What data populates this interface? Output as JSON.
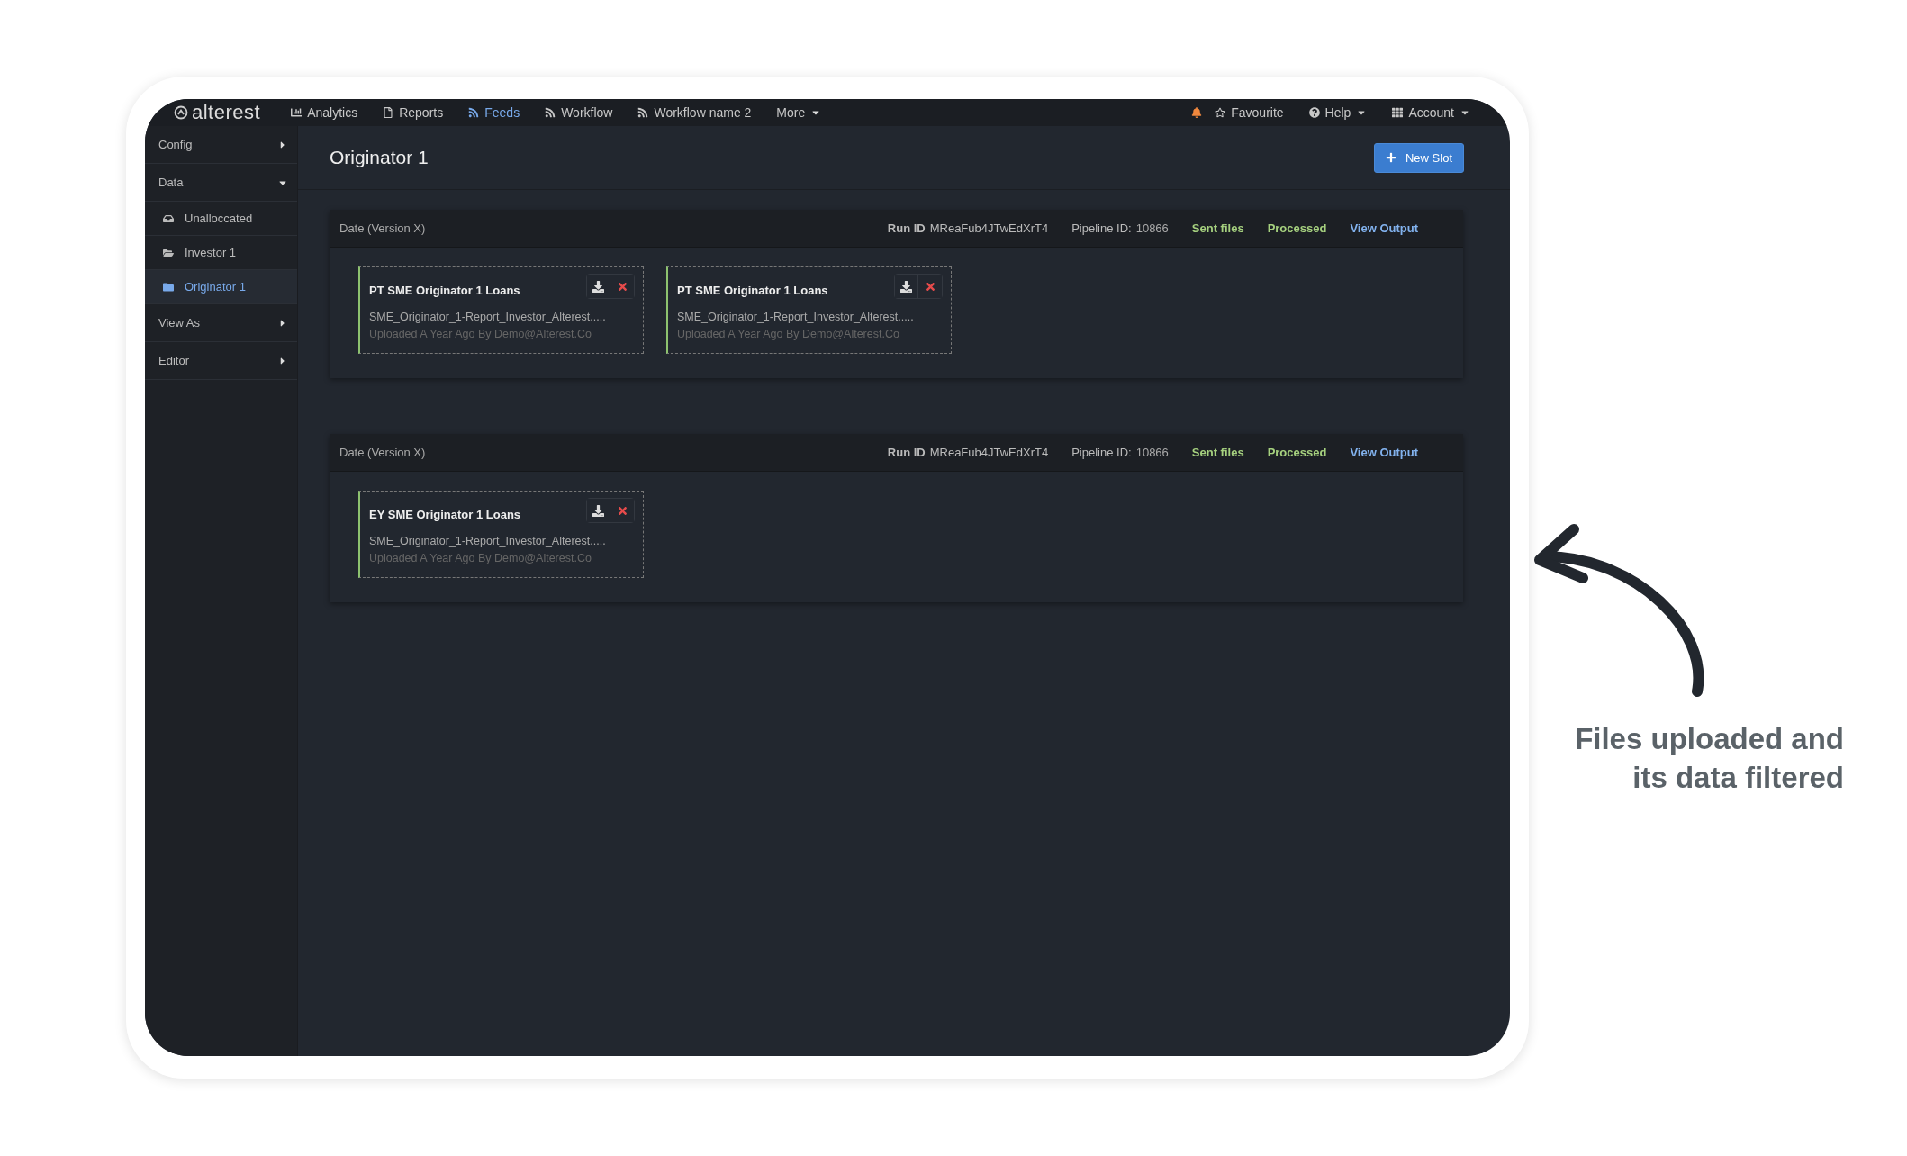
{
  "nav": {
    "logo": "alterest",
    "items": [
      {
        "label": "Analytics",
        "kind": "chart",
        "selected": false
      },
      {
        "label": "Reports",
        "kind": "report",
        "selected": false
      },
      {
        "label": "Feeds",
        "kind": "feed",
        "selected": true
      },
      {
        "label": "Workflow",
        "kind": "feed",
        "selected": false
      },
      {
        "label": "Workflow name 2",
        "kind": "feed",
        "selected": false
      }
    ],
    "more": "More",
    "favourite": "Favourite",
    "help": "Help",
    "account": "Account"
  },
  "sidebar": {
    "items": [
      {
        "kind": "section",
        "label": "Config",
        "expanded": false
      },
      {
        "kind": "section",
        "label": "Data",
        "expanded": true
      },
      {
        "kind": "tray",
        "label": "Unalloccated",
        "selected": false
      },
      {
        "kind": "folder",
        "label": "Investor 1",
        "selected": false
      },
      {
        "kind": "folder",
        "label": "Originator 1",
        "selected": true
      },
      {
        "kind": "section",
        "label": "View As",
        "expanded": false
      },
      {
        "kind": "section",
        "label": "Editor",
        "expanded": false
      }
    ]
  },
  "page": {
    "title": "Originator 1",
    "new_slot": "New Slot"
  },
  "sections": [
    {
      "date": "Date (Version X)",
      "run_id_label": "Run ID",
      "run_id": "MReaFub4JTwEdXrT4",
      "pipeline_label": "Pipeline ID:",
      "pipeline_id": "10866",
      "sent": "Sent files",
      "processed": "Processed",
      "view_output": "View Output",
      "files": [
        {
          "title": "PT SME Originator 1 Loans",
          "filename": "SME_Originator_1-Report_Investor_Alterest.....",
          "uploaded": "Uploaded A Year Ago By Demo@Alterest.Co"
        },
        {
          "title": "PT SME Originator 1 Loans",
          "filename": "SME_Originator_1-Report_Investor_Alterest.....",
          "uploaded": "Uploaded A Year Ago By Demo@Alterest.Co"
        }
      ]
    },
    {
      "date": "Date (Version X)",
      "run_id_label": "Run ID",
      "run_id": "MReaFub4JTwEdXrT4",
      "pipeline_label": "Pipeline ID:",
      "pipeline_id": "10866",
      "sent": "Sent files",
      "processed": "Processed",
      "view_output": "View Output",
      "files": [
        {
          "title": "EY SME Originator 1 Loans",
          "filename": "SME_Originator_1-Report_Investor_Alterest.....",
          "uploaded": "Uploaded A Year Ago By Demo@Alterest.Co"
        }
      ]
    }
  ],
  "annotation": {
    "lines": [
      "Files uploaded and",
      "its data filtered"
    ]
  }
}
